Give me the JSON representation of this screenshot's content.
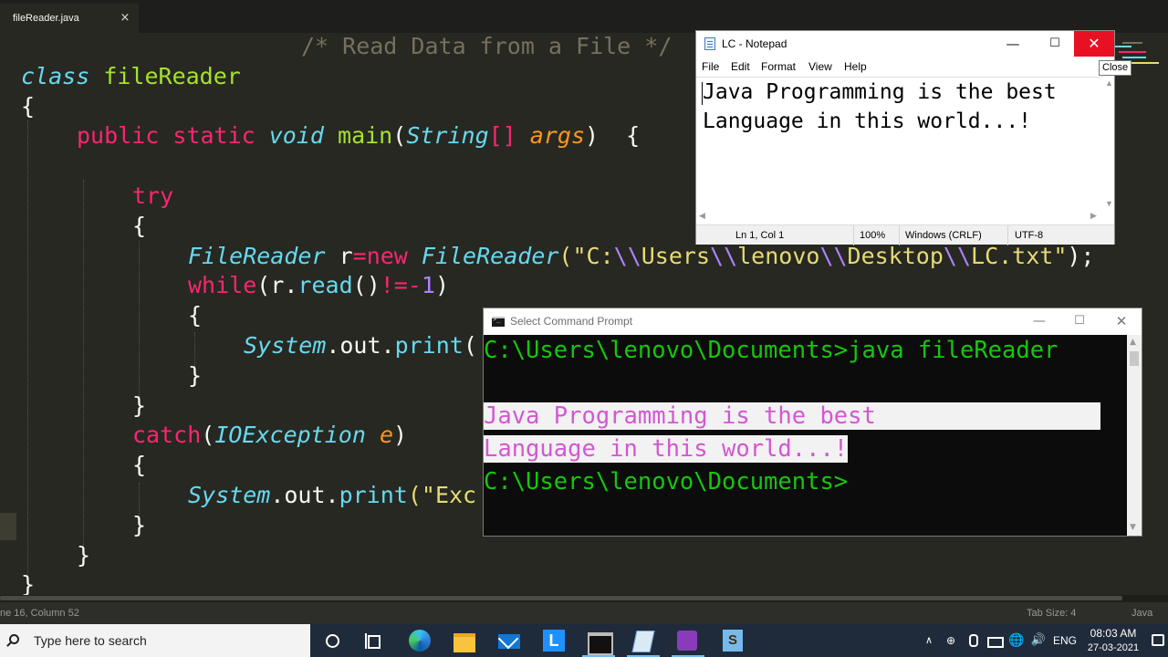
{
  "editor": {
    "tab_label": "fileReader.java",
    "tab_close": "×",
    "code_lines": [
      [
        {
          "t": "/* Read Data from a File */",
          "c": "cm"
        }
      ],
      [
        {
          "t": "class",
          "c": "cy it"
        },
        {
          "t": " ",
          "c": "wh"
        },
        {
          "t": "fileReader",
          "c": "gn"
        }
      ],
      [
        {
          "t": "{",
          "c": "wh"
        }
      ],
      [
        {
          "t": "public",
          "c": "kw"
        },
        {
          "t": " ",
          "c": "wh"
        },
        {
          "t": "static",
          "c": "kw"
        },
        {
          "t": " ",
          "c": "wh"
        },
        {
          "t": "void",
          "c": "cy it"
        },
        {
          "t": " ",
          "c": "wh"
        },
        {
          "t": "main",
          "c": "gn"
        },
        {
          "t": "(",
          "c": "wh"
        },
        {
          "t": "String",
          "c": "cy it"
        },
        {
          "t": "[]",
          "c": "kw"
        },
        {
          "t": " ",
          "c": "wh"
        },
        {
          "t": "args",
          "c": "or it"
        },
        {
          "t": ")  {",
          "c": "wh"
        }
      ],
      [],
      [
        {
          "t": "try",
          "c": "kw"
        }
      ],
      [
        {
          "t": "{",
          "c": "wh"
        }
      ],
      [
        {
          "t": "FileReader",
          "c": "cy it"
        },
        {
          "t": " r",
          "c": "wh"
        },
        {
          "t": "=",
          "c": "kw"
        },
        {
          "t": "new",
          "c": "kw"
        },
        {
          "t": " ",
          "c": "wh"
        },
        {
          "t": "FileReader",
          "c": "cy it"
        },
        {
          "t": "(\"C:",
          "c": "ye"
        },
        {
          "t": "\\\\",
          "c": "pu"
        },
        {
          "t": "Users",
          "c": "ye"
        },
        {
          "t": "\\\\",
          "c": "pu"
        },
        {
          "t": "lenovo",
          "c": "ye"
        },
        {
          "t": "\\\\",
          "c": "pu"
        },
        {
          "t": "Desktop",
          "c": "ye"
        },
        {
          "t": "\\\\",
          "c": "pu"
        },
        {
          "t": "LC.txt\"",
          "c": "ye"
        },
        {
          "t": ");",
          "c": "wh"
        }
      ],
      [
        {
          "t": "while",
          "c": "kw"
        },
        {
          "t": "(r.",
          "c": "wh"
        },
        {
          "t": "read",
          "c": "cy"
        },
        {
          "t": "()",
          "c": "wh"
        },
        {
          "t": "!=-",
          "c": "kw"
        },
        {
          "t": "1",
          "c": "pu"
        },
        {
          "t": ")",
          "c": "wh"
        }
      ],
      [
        {
          "t": "{",
          "c": "wh"
        }
      ],
      [
        {
          "t": "System",
          "c": "cy it"
        },
        {
          "t": ".out.",
          "c": "wh"
        },
        {
          "t": "print",
          "c": "cy"
        },
        {
          "t": "(",
          "c": "wh"
        }
      ],
      [
        {
          "t": "}",
          "c": "wh"
        }
      ],
      [
        {
          "t": "}",
          "c": "wh"
        }
      ],
      [
        {
          "t": "catch",
          "c": "kw"
        },
        {
          "t": "(",
          "c": "wh"
        },
        {
          "t": "IOException",
          "c": "cy it"
        },
        {
          "t": " ",
          "c": "wh"
        },
        {
          "t": "e",
          "c": "or it"
        },
        {
          "t": ")",
          "c": "wh"
        }
      ],
      [
        {
          "t": "{",
          "c": "wh"
        }
      ],
      [
        {
          "t": "System",
          "c": "cy it"
        },
        {
          "t": ".out.",
          "c": "wh"
        },
        {
          "t": "print",
          "c": "cy"
        },
        {
          "t": "(\"Exc",
          "c": "ye"
        }
      ],
      [
        {
          "t": "}",
          "c": "wh"
        }
      ],
      [
        {
          "t": "}",
          "c": "wh"
        }
      ],
      [
        {
          "t": "}",
          "c": "wh"
        }
      ]
    ],
    "status_position": "ne 16, Column 52",
    "status_tab_size": "Tab Size: 4",
    "status_language": "Java"
  },
  "notepad": {
    "title": "LC - Notepad",
    "min_glyph": "—",
    "max_glyph": "☐",
    "close_glyph": "✕",
    "close_tooltip": "Close",
    "menu": [
      "File",
      "Edit",
      "Format",
      "View",
      "Help"
    ],
    "content_lines": [
      "Java Programming is the best",
      "Language in this world...!"
    ],
    "status": {
      "position": "Ln 1, Col 1",
      "zoom": "100%",
      "line_ending": "Windows (CRLF)",
      "encoding": "UTF-8"
    }
  },
  "cmd": {
    "title": "Select Command Prompt",
    "min_glyph": "—",
    "max_glyph": "☐",
    "close_glyph": "✕",
    "lines": [
      {
        "text": "C:\\Users\\lenovo\\Documents>java fileReader",
        "selected": false
      },
      {
        "text": "",
        "selected": false
      },
      {
        "text": "Java Programming is the best                ",
        "selected": true
      },
      {
        "text": "Language in this world...!",
        "selected": true
      },
      {
        "text": "C:\\Users\\lenovo\\Documents>",
        "selected": false
      }
    ]
  },
  "taskbar": {
    "search_placeholder": "Type here to search",
    "tray_chevron": "∧",
    "tray_net": "⊕",
    "tray_globe": "🌐",
    "tray_volume": "🔊",
    "language": "ENG",
    "time": "08:03 AM",
    "date": "27-03-2021"
  }
}
